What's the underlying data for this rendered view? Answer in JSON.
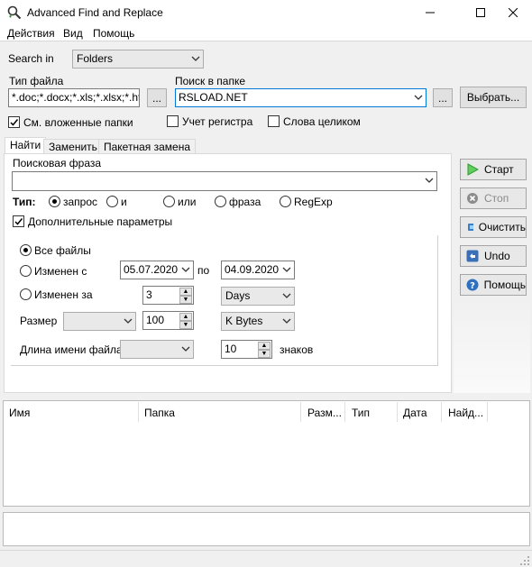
{
  "window": {
    "title": "Advanced Find and Replace",
    "minimize": "—",
    "maximize": "☐",
    "close": "✕"
  },
  "menu": [
    "Действия",
    "Вид",
    "Помощь"
  ],
  "search_in": {
    "label": "Search in",
    "value": "Folders"
  },
  "file_type": {
    "label": "Тип файла",
    "value": "*.doc;*.docx;*.xls;*.xlsx;*.ht",
    "browse": "..."
  },
  "folder": {
    "label": "Поиск в папке",
    "value": "RSLOAD.NET",
    "browse": "...",
    "choose": "Выбрать..."
  },
  "options": {
    "subfolders": "См. вложенные папки",
    "case": "Учет регистра",
    "whole_words": "Слова целиком"
  },
  "tabs": [
    "Найти",
    "Заменить",
    "Пакетная замена"
  ],
  "find": {
    "phrase_label": "Поисковая фраза",
    "phrase_value": "",
    "type_label": "Тип:",
    "types": [
      "запрос",
      "и",
      "или",
      "фраза",
      "RegExp"
    ],
    "advanced_label": "Дополнительные параметры"
  },
  "advanced": {
    "all_files": "Все файлы",
    "modified_from": "Изменен с",
    "date_from": "05.07.2020",
    "to": "по",
    "date_to": "04.09.2020",
    "modified_within": "Изменен за",
    "within_value": "3",
    "within_unit": "Days",
    "size_label": "Размер",
    "size_op": "",
    "size_value": "100",
    "size_unit": "K Bytes",
    "name_len_label": "Длина имени файла",
    "name_len_op": "",
    "name_len_value": "10",
    "name_len_unit": "знаков"
  },
  "side_buttons": {
    "start": "Старт",
    "stop": "Стоп",
    "clear": "Очистить",
    "undo": "Undo",
    "help": "Помощь"
  },
  "results": {
    "columns": [
      "Имя",
      "Папка",
      "Разм...",
      "Тип",
      "Дата",
      "Найд..."
    ]
  },
  "colors": {
    "accent": "#0078d7",
    "start_green": "#2e9e2e"
  }
}
